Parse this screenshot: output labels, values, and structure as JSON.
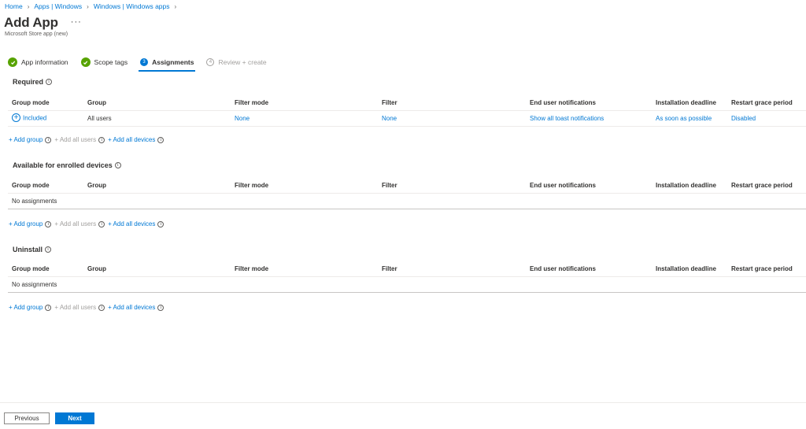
{
  "breadcrumb": [
    "Home",
    "Apps | Windows",
    "Windows | Windows apps"
  ],
  "page": {
    "title": "Add App",
    "subtitle": "Microsoft Store app (new)",
    "more": "···"
  },
  "wizard": {
    "steps": [
      {
        "label": "App information",
        "state": "done"
      },
      {
        "label": "Scope tags",
        "state": "done"
      },
      {
        "label": "Assignments",
        "state": "current",
        "number": "3"
      },
      {
        "label": "Review + create",
        "state": "disabled",
        "number": "4"
      }
    ]
  },
  "columns": [
    "Group mode",
    "Group",
    "Filter mode",
    "Filter",
    "End user notifications",
    "Installation deadline",
    "Restart grace period"
  ],
  "sections": {
    "required": {
      "title": "Required",
      "row": {
        "group_mode": "Included",
        "group": "All users",
        "filter_mode": "None",
        "filter": "None",
        "notifications": "Show all toast notifications",
        "deadline": "As soon as possible",
        "restart": "Disabled"
      }
    },
    "available": {
      "title": "Available for enrolled devices",
      "empty": "No assignments"
    },
    "uninstall": {
      "title": "Uninstall",
      "empty": "No assignments"
    }
  },
  "add_links": {
    "add_group": "+ Add group",
    "add_all_users": "+ Add all users",
    "add_all_devices": "+ Add all devices"
  },
  "footer": {
    "previous": "Previous",
    "next": "Next"
  },
  "colors": {
    "accent": "#0078d4",
    "success": "#57a300",
    "text": "#323130",
    "muted": "#a19f9d"
  }
}
